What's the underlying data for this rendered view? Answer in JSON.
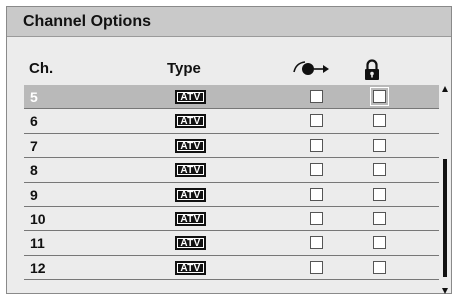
{
  "panel": {
    "title": "Channel Options"
  },
  "header": {
    "channel_label": "Ch.",
    "type_label": "Type",
    "skip_icon": "skip-channel-icon",
    "lock_icon": "lock-icon"
  },
  "rows": [
    {
      "channel": "5",
      "type": "ATV",
      "skip": false,
      "lock": false,
      "selected": true
    },
    {
      "channel": "6",
      "type": "ATV",
      "skip": false,
      "lock": false,
      "selected": false
    },
    {
      "channel": "7",
      "type": "ATV",
      "skip": false,
      "lock": false,
      "selected": false
    },
    {
      "channel": "8",
      "type": "ATV",
      "skip": false,
      "lock": false,
      "selected": false
    },
    {
      "channel": "9",
      "type": "ATV",
      "skip": false,
      "lock": false,
      "selected": false
    },
    {
      "channel": "10",
      "type": "ATV",
      "skip": false,
      "lock": false,
      "selected": false
    },
    {
      "channel": "11",
      "type": "ATV",
      "skip": false,
      "lock": false,
      "selected": false
    },
    {
      "channel": "12",
      "type": "ATV",
      "skip": false,
      "lock": false,
      "selected": false
    }
  ],
  "colors": {
    "title_bar": "#c9c9c9",
    "panel_bg": "#ececec",
    "selected_row": "#b9b9b9",
    "badge_bg": "#111111"
  }
}
